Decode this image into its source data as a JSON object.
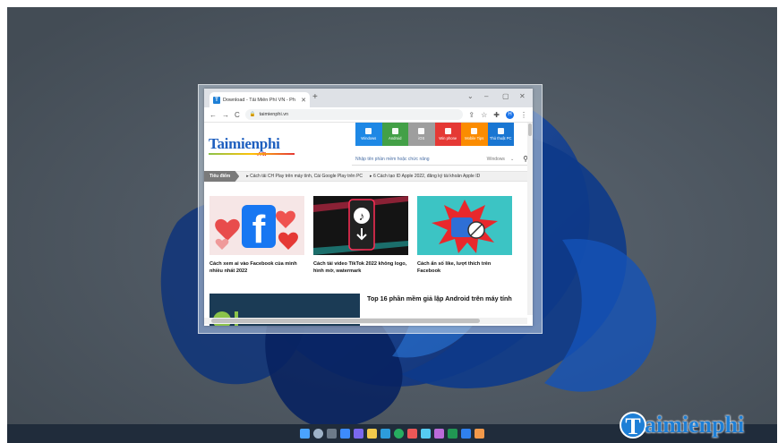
{
  "browser": {
    "tab_title": "Download - Tải Miễn Phí VN - Ph",
    "tab_favicon": "T",
    "url": "taimienphi.vn",
    "avatar_initial": "H"
  },
  "site": {
    "logo_main": "Taimienphi",
    "logo_sub": ".vn",
    "categories": [
      {
        "label": "Windows",
        "color": "#1e88e5"
      },
      {
        "label": "Android",
        "color": "#43a047"
      },
      {
        "label": "iOS",
        "color": "#9e9e9e"
      },
      {
        "label": "Win phone",
        "color": "#e53935"
      },
      {
        "label": "Mobile Tips",
        "color": "#fb8c00"
      },
      {
        "label": "Thủ thuật PC",
        "color": "#1976d2"
      }
    ],
    "search_placeholder": "Nhập tên phần mềm hoặc chức năng",
    "search_platform": "Windows",
    "ticker_label": "Tiêu điểm",
    "ticker_items": [
      "Cách tải CH Play trên máy tính, Cài Google Play trên PC",
      "6 Cách tạo ID Apple 2022, đăng ký tài khoản Apple ID"
    ],
    "cards": [
      {
        "title": "Cách xem ai vào Facebook của mình nhiều nhất 2022"
      },
      {
        "title": "Cách tải video TikTok 2022 không logo, hình mờ, watermark"
      },
      {
        "title": "Cách ẩn số like, lượt thích trên Facebook"
      }
    ],
    "featured_title": "Top 16 phần mềm giả lập Android trên máy tính"
  },
  "brand_watermark": "aimienphi",
  "brand_watermark_letter": "T"
}
